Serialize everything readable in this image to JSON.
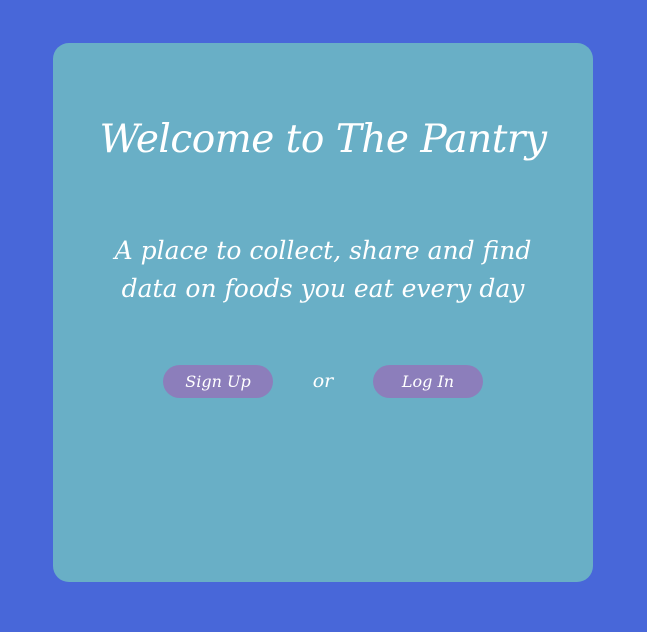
{
  "colors": {
    "background": "#4867d9",
    "card": "#69afc6",
    "button": "#8c7ebb",
    "text": "#ffffff"
  },
  "welcome": {
    "title": "Welcome to The Pantry",
    "subtitle": "A place to collect, share and find data on foods you eat every day"
  },
  "actions": {
    "signup_label": "Sign Up",
    "separator": "or",
    "login_label": "Log In"
  }
}
